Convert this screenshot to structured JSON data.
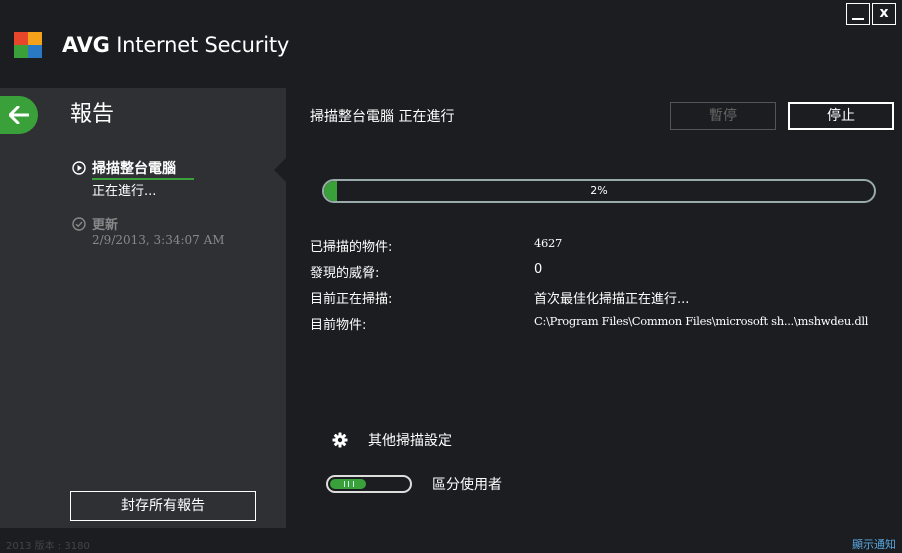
{
  "app": {
    "title_bold": "AVG",
    "title_rest": " Internet Security",
    "brand_colors": [
      "#e8462b",
      "#f5a21b",
      "#3aa13a",
      "#2a79c4"
    ]
  },
  "window": {
    "minimize_icon": "minimize-icon",
    "close_label": "x"
  },
  "sidebar": {
    "title": "報告",
    "items": [
      {
        "label": "掃描整台電腦",
        "sub": "正在進行...",
        "icon": "play-circle-icon",
        "active": true
      },
      {
        "label": "更新",
        "sub": "2/9/2013, 3:34:07 AM",
        "icon": "check-circle-icon",
        "active": false
      }
    ],
    "archive_label": "封存所有報告"
  },
  "main": {
    "title": "掃描整台電腦 正在進行",
    "pause_label": "暫停",
    "stop_label": "停止",
    "progress": {
      "value": 0.02,
      "label": "2%"
    },
    "info": [
      {
        "key": "已掃描的物件:",
        "value": "4627"
      },
      {
        "key": "發現的威脅:",
        "value": "0"
      },
      {
        "key": "目前正在掃描:",
        "value": "首次最佳化掃描正在進行..."
      },
      {
        "key": "目前物件:",
        "value": "C:\\Program Files\\Common Files\\microsoft sh...\\mshwdeu.dll"
      }
    ],
    "options_label": "其他掃描設定",
    "user_toggle_label": "區分使用者",
    "accent": "#3aa13a"
  },
  "status": {
    "version": "2013  版本 : 3180",
    "notify": "顯示通知"
  }
}
